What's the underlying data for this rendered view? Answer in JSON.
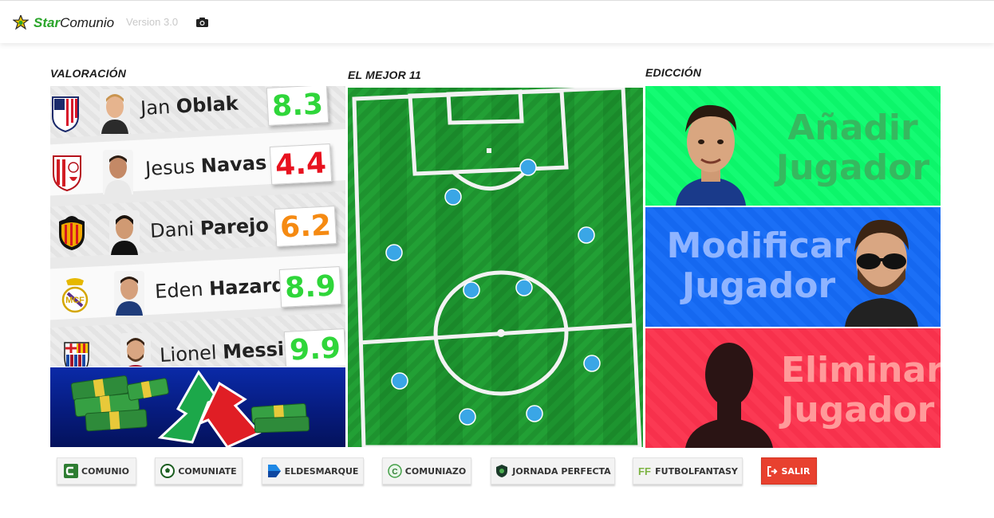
{
  "header": {
    "brand_prefix": "Star",
    "brand_suffix": "Comunio",
    "version": "Version 3.0",
    "star_icon": "star-badge-icon",
    "camera_icon": "camera-icon"
  },
  "sections": {
    "ratings_title": "VALORACIÓN",
    "pitch_title": "EL MEJOR 11",
    "edit_title": "EDICCIÓN"
  },
  "ratings": [
    {
      "first": "Jan",
      "last": "Oblak",
      "score": "8.3",
      "color": "#2fd63a",
      "club": "atletico-madrid"
    },
    {
      "first": "Jesus",
      "last": "Navas",
      "score": "4.4",
      "color": "#e8121f",
      "club": "sevilla"
    },
    {
      "first": "Dani",
      "last": "Parejo",
      "score": "6.2",
      "color": "#f58a12",
      "club": "valencia"
    },
    {
      "first": "Eden",
      "last": "Hazard",
      "score": "8.9",
      "color": "#2fd63a",
      "club": "real-madrid"
    },
    {
      "first": "Lionel",
      "last": "Messi",
      "score": "9.9",
      "color": "#2fd63a",
      "club": "barcelona"
    }
  ],
  "edit": {
    "add": {
      "line1": "Añadir",
      "line2": "Jugador"
    },
    "modify": {
      "line1": "Modificar",
      "line2": "Jugador"
    },
    "remove": {
      "line1": "Eliminar",
      "line2": "Jugador"
    }
  },
  "links": [
    {
      "label": "COMUNIO",
      "icon": "comunio-icon"
    },
    {
      "label": "COMUNIATE",
      "icon": "ball-icon"
    },
    {
      "label": "ELDESMARQUE",
      "icon": "eldesmarque-icon"
    },
    {
      "label": "COMUNIAZO",
      "icon": "comuniazo-icon"
    },
    {
      "label": "JORNADA PERFECTA",
      "icon": "shield-icon"
    },
    {
      "label": "FUTBOLFANTASY",
      "icon": "ff-icon"
    }
  ],
  "exit": {
    "label": "SALIR",
    "icon": "sign-out-icon",
    "color": "#e8412f"
  },
  "colors": {
    "add_card": "#0cf56a",
    "modify_card": "#1568f0",
    "remove_card": "#f7314c",
    "pitch": "#1c8f2c",
    "player_dot": "#3aa6e6"
  }
}
